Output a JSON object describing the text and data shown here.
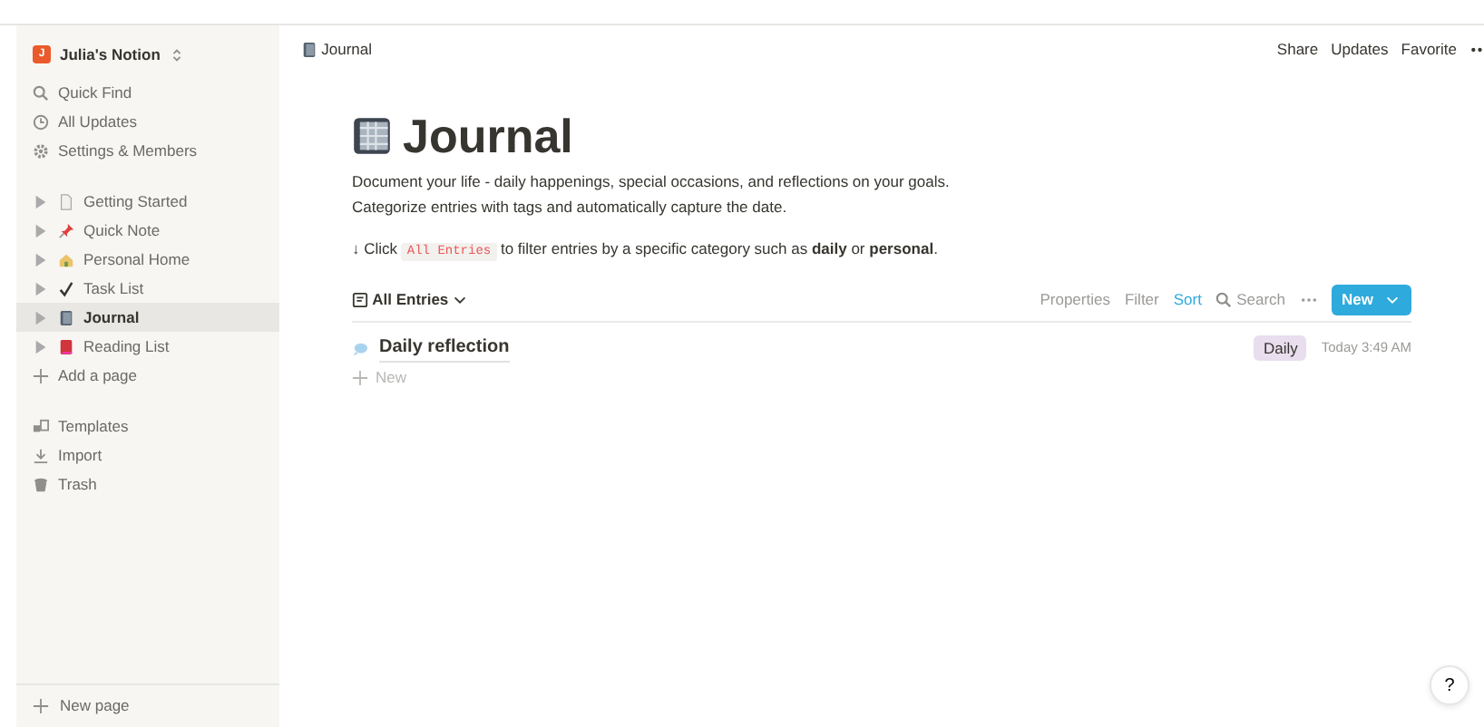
{
  "sidebar": {
    "workspace": {
      "initial": "J",
      "name": "Julia's Notion"
    },
    "top_items": [
      {
        "label": "Quick Find"
      },
      {
        "label": "All Updates"
      },
      {
        "label": "Settings & Members"
      }
    ],
    "pages": [
      {
        "label": "Getting Started",
        "selected": false
      },
      {
        "label": "Quick Note",
        "selected": false
      },
      {
        "label": "Personal Home",
        "selected": false
      },
      {
        "label": "Task List",
        "selected": false
      },
      {
        "label": "Journal",
        "selected": true
      },
      {
        "label": "Reading List",
        "selected": false
      }
    ],
    "add_page": "Add a page",
    "bottom_items": [
      {
        "label": "Templates"
      },
      {
        "label": "Import"
      },
      {
        "label": "Trash"
      }
    ],
    "new_page": "New page"
  },
  "topbar": {
    "breadcrumb": "Journal",
    "actions": [
      "Share",
      "Updates",
      "Favorite"
    ]
  },
  "page": {
    "title": "Journal",
    "description": [
      "Document your life - daily happenings, special occasions, and reflections on your goals.",
      "Categorize entries with tags and automatically capture the date."
    ],
    "hint": {
      "before": "↓ Click",
      "code": "All Entries",
      "after": "to filter entries by a specific category such as **daily** or **personal**."
    },
    "view": "All Entries",
    "toolbar": [
      {
        "label": "Properties",
        "active": false
      },
      {
        "label": "Filter",
        "active": false
      },
      {
        "label": "Sort",
        "active": true
      },
      {
        "label": "Search",
        "active": false
      }
    ],
    "new_button": "New",
    "entries": [
      {
        "title": "Daily reflection",
        "tag": "Daily",
        "color": "#e8deee",
        "time": "Today 3:49 AM"
      }
    ],
    "add_row": "New"
  },
  "help": "?"
}
